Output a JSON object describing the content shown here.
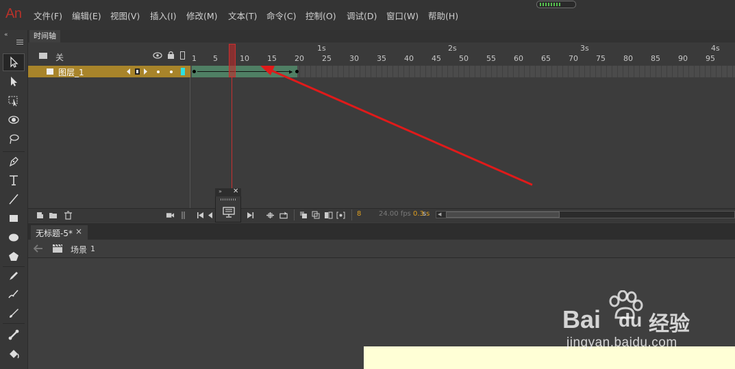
{
  "app": {
    "logo": "An",
    "menu": [
      "文件(F)",
      "编辑(E)",
      "视图(V)",
      "插入(I)",
      "修改(M)",
      "文本(T)",
      "命令(C)",
      "控制(O)",
      "调试(D)",
      "窗口(W)",
      "帮助(H)"
    ]
  },
  "timeline": {
    "tab_label": "时间轴",
    "scene_toggle_label": "关",
    "layer_name": "图层_1",
    "second_labels": [
      "1s",
      "2s",
      "3s",
      "4s"
    ],
    "frame_numbers": [
      "1",
      "5",
      "10",
      "15",
      "20",
      "25",
      "30",
      "35",
      "40",
      "45",
      "50",
      "55",
      "60",
      "65",
      "70",
      "75",
      "80",
      "85",
      "90",
      "95"
    ],
    "current_frame": "8",
    "fps": "24.00 fps",
    "elapsed": "0.3 s",
    "elapsed_unit": "s"
  },
  "document": {
    "tab_title": "无标题-5*",
    "close_glyph": "×",
    "scene_label": "场景",
    "scene_number": "1"
  },
  "watermark": {
    "brand": "Bai",
    "brand2": "du",
    "cn": "经验",
    "url": "jingyan.baidu.com"
  },
  "colors": {
    "accent_red": "#c83030",
    "layer_highlight": "#a8842a",
    "tween_green": "#4f7f64",
    "stage": "#ffffd6"
  }
}
